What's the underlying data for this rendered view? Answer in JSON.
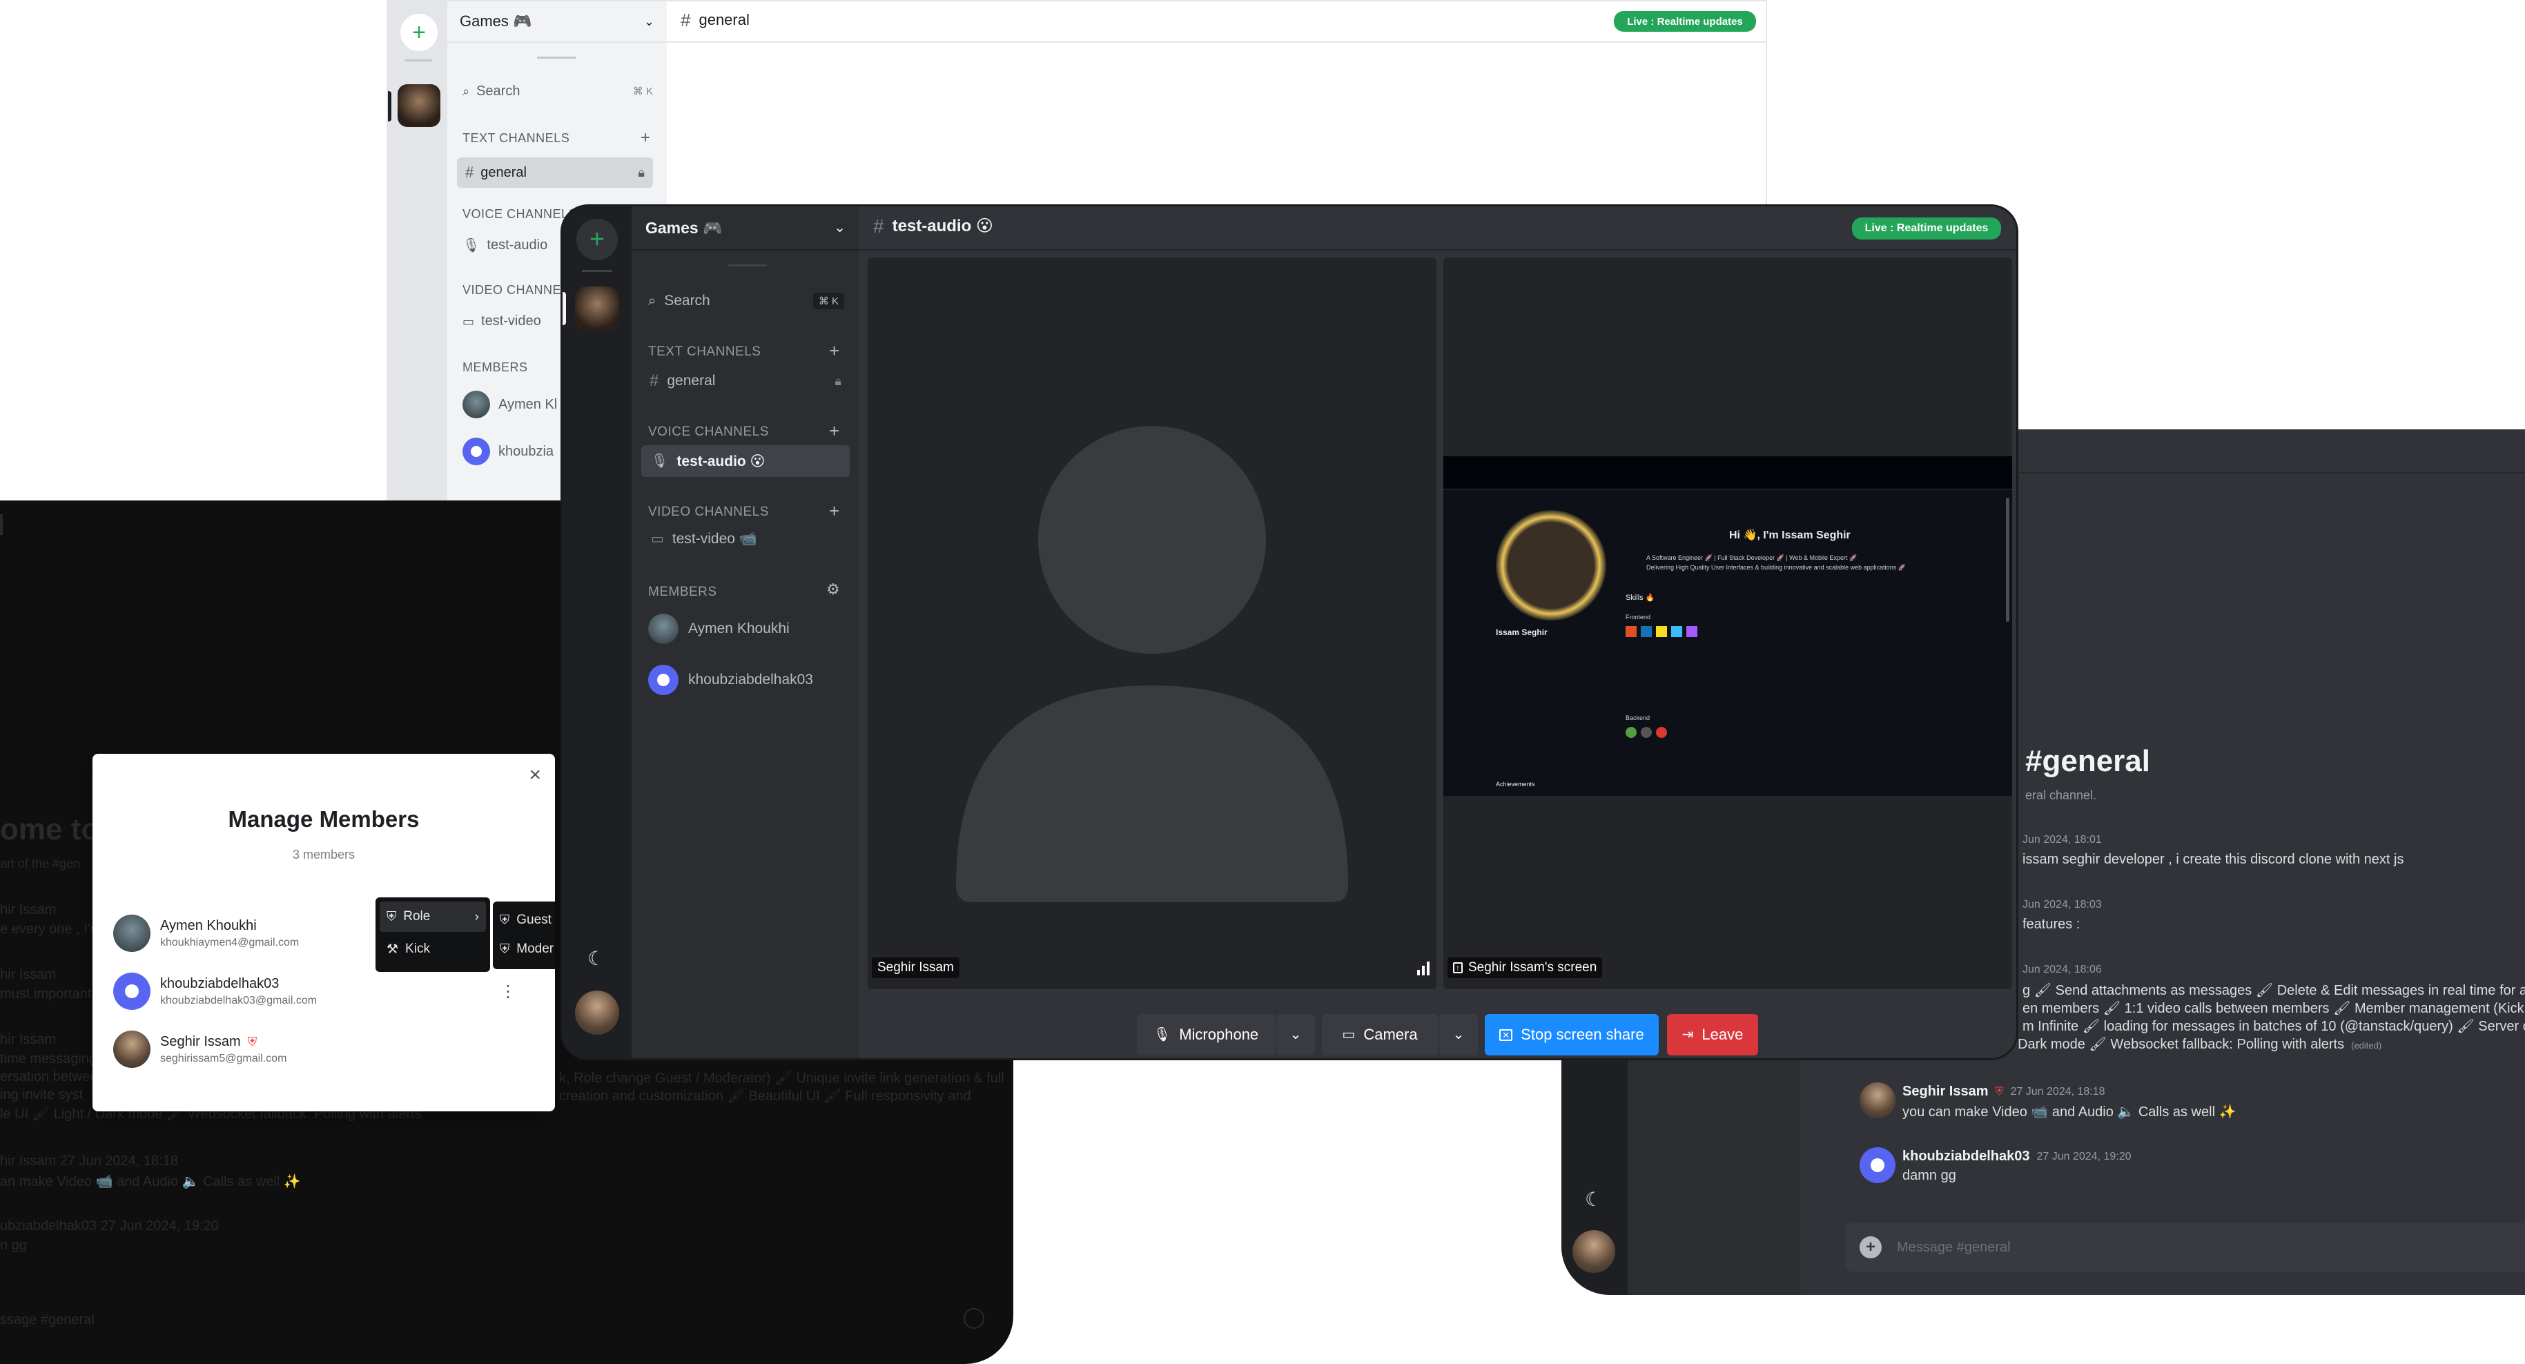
{
  "light_window": {
    "server_name": "Games 🎮",
    "channel_title": "general",
    "live_badge": "Live : Realtime updates",
    "search_label": "Search",
    "search_shortcut": "⌘ K",
    "text_channels_label": "TEXT CHANNELS",
    "text_channel": "general",
    "voice_channels_label": "VOICE CHANNELS",
    "voice_channel": "test-audio",
    "video_channels_label": "VIDEO CHANNE",
    "video_channel": "test-video",
    "members_label": "MEMBERS",
    "member_1": "Aymen Kl",
    "member_2": "khoubzia"
  },
  "manage_modal": {
    "title": "Manage Members",
    "count": "3 members",
    "close_glyph": "×",
    "members": [
      {
        "name": "Aymen Khoukhi",
        "email": "khoukhiaymen4@gmail.com"
      },
      {
        "name": "khoubziabdelhak03",
        "email": "khoubziabdelhak03@gmail.com"
      },
      {
        "name": "Seghir Issam",
        "email": "seghirissam5@gmail.com"
      }
    ],
    "menu": {
      "role": "Role",
      "kick": "Kick",
      "guest": "Guest",
      "moderator": "Moder"
    }
  },
  "left_dark_bg": {
    "welcome": "ome to",
    "line_1": "art of the #gen",
    "line_2": "hir Issam",
    "line_3": "e every one , I'm",
    "line_4": "hir Issam",
    "line_5": "must important",
    "line_6": "hir Issam",
    "line_7": "time messaging",
    "line_8": "ersation betwee",
    "line_9": "ing invite syst",
    "line_10": "le UI 🖌 Light / Dark mode 🖌 Websocket fallback: Polling with alerts",
    "line_11": "k, Role change Guest / Moderator) 🖌 Unique invite link generation & full",
    "line_12": "creation and customization 🖌 Beautiful UI 🖌 Full responsivity and",
    "line_13": "hir Issam  27 Jun 2024, 18:18",
    "line_14": "an make Video 📹 and Audio 🔈 Calls as well ✨",
    "line_15": "ubziabdelhak03  27 Jun 2024, 19:20",
    "line_16": "n gg",
    "line_17": "ssage #general"
  },
  "right_window": {
    "channel_title": "#general",
    "channel_sub": "eral channel.",
    "messages": [
      {
        "time": "Jun 2024, 18:01",
        "text": "issam seghir developer , i create this discord clone with next js"
      },
      {
        "time": "Jun 2024, 18:03",
        "text": "features :"
      },
      {
        "time": "Jun 2024, 18:06",
        "text": "g 🖌 Send attachments as messages 🖌 Delete & Edit messages in real time for all user"
      },
      {
        "time": "",
        "text": "en members 🖌 1:1 video calls between members 🖌 Member management (Kick, Rol"
      },
      {
        "time": "",
        "text": "m Infinite 🖌 loading for messages in batches of 10 (@tanstack/query) 🖌 Server creat"
      },
      {
        "time": "",
        "text": "/ Dark mode 🖌 Websocket fallback: Polling with alerts"
      }
    ],
    "edited": "(edited)",
    "msg_user_1": "Seghir Issam",
    "msg_time_1": "27 Jun 2024, 18:18",
    "msg_text_1": "you can make Video 📹 and Audio 🔈 Calls as well ✨",
    "msg_user_2": "khoubziabdelhak03",
    "msg_time_2": "27 Jun 2024, 19:20",
    "msg_text_2": "damn gg",
    "input_placeholder": "Message #general"
  },
  "main_window": {
    "server_name": "Games 🎮",
    "channel_title": "test-audio 😮",
    "live_badge": "Live : Realtime updates",
    "search_label": "Search",
    "search_shortcut": "⌘ K",
    "text_channels_label": "TEXT CHANNELS",
    "text_channel": "general",
    "voice_channels_label": "VOICE CHANNELS",
    "voice_channel": "test-audio 😮",
    "video_channels_label": "VIDEO CHANNELS",
    "video_channel": "test-video 📹",
    "members_label": "MEMBERS",
    "member_1": "Aymen Khoukhi",
    "member_2": "khoubziabdelhak03",
    "tile_1_label": "Seghir Issam",
    "tile_2_label": "Seghir Issam's screen",
    "share_screen": {
      "profile_title": "Hi 👋, I'm Issam Seghir",
      "profile_line_1": "A Software Engineer 🚀 | Full Stack Developer 🚀 | Web & Mobile Expert 🚀",
      "profile_line_2": "Delivering High Quality User Interfaces & building innovative and scalable web applications 🚀",
      "skills": "Skills 🔥",
      "frontend": "Frontend",
      "backend": "Backend",
      "profile_name": "Issam Seghir",
      "achievements": "Achievements"
    },
    "controls": {
      "microphone": "Microphone",
      "camera": "Camera",
      "stop_share": "Stop screen share",
      "leave": "Leave"
    }
  },
  "colors": {
    "accent_green": "#23a55a",
    "brand_blue": "#5865f2",
    "share_blue": "#1a8cff",
    "leave_red": "#da373c"
  }
}
